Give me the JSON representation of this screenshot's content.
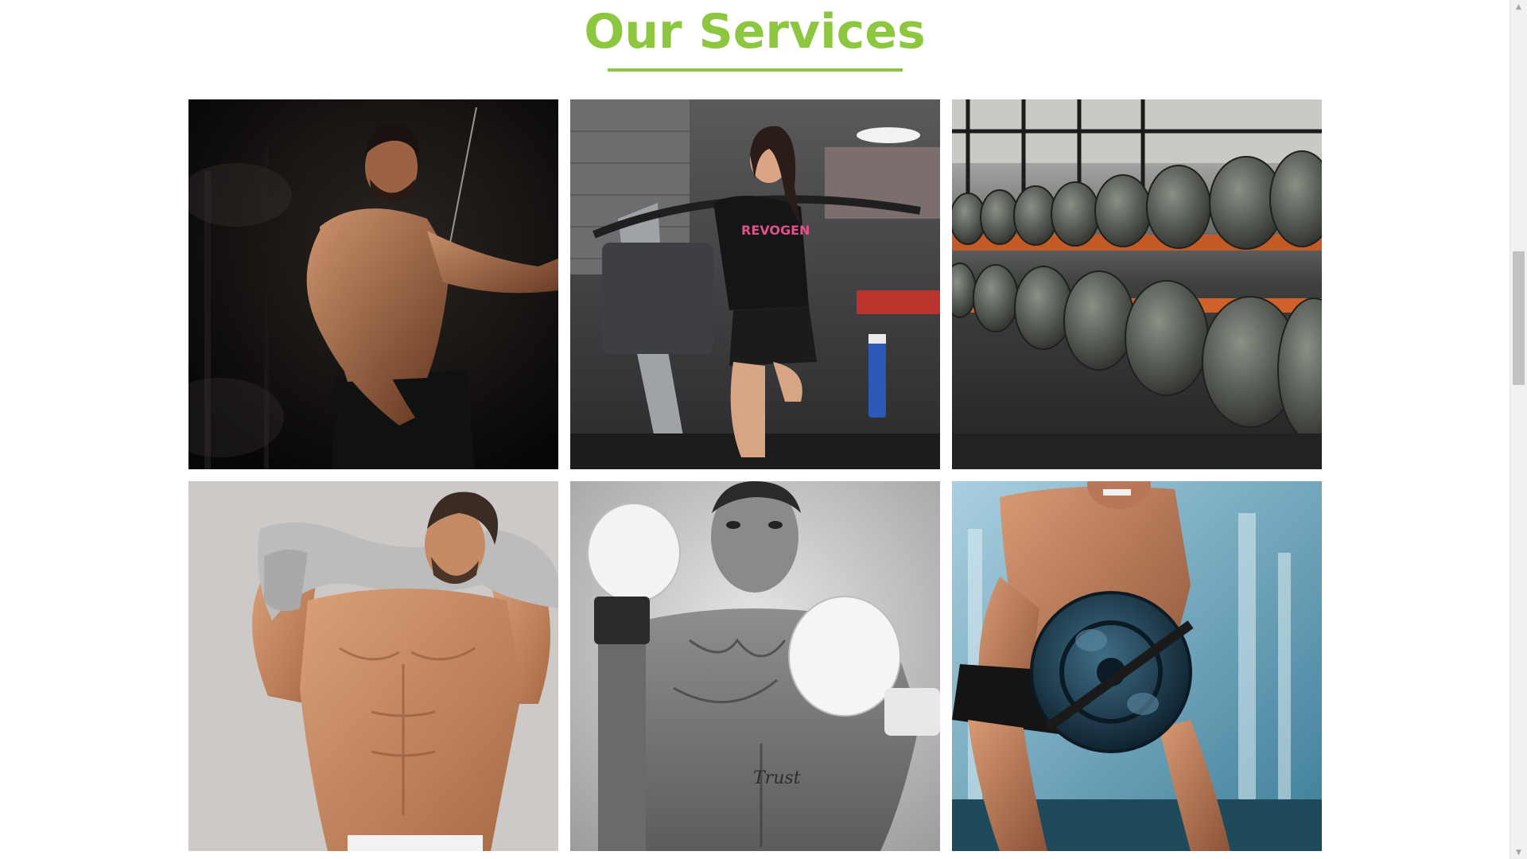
{
  "section": {
    "title": "Our Services",
    "accent_color": "#8dc63f"
  },
  "services": [
    {
      "name": "bodybuilding-cable-curl-photo"
    },
    {
      "name": "cardio-elliptical-photo"
    },
    {
      "name": "dumbbell-rack-photo"
    },
    {
      "name": "fitness-model-towel-photo"
    },
    {
      "name": "boxing-gloves-photo"
    },
    {
      "name": "weight-plate-training-photo"
    }
  ],
  "scrollbar": {
    "up_icon": "triangle-up-icon",
    "down_icon": "triangle-down-icon",
    "position_fraction": 0.34
  }
}
